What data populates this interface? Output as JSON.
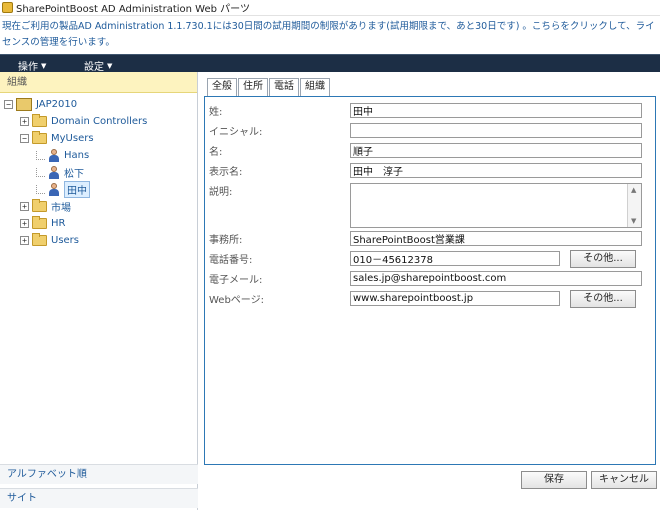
{
  "window": {
    "title": "SharePointBoost AD Administration Web パーツ",
    "icon": "app-icon"
  },
  "notice": {
    "text": "現在ご利用の製品AD Administration 1.1.730.1には30日間の試用期間の制限があります(試用期限まで、あと30日です) 。こちらをクリックして、ライセンスの管理を行います。"
  },
  "menu": {
    "items": [
      {
        "label": "操作",
        "icon": "caret-down-icon"
      },
      {
        "label": "設定",
        "icon": "caret-down-icon"
      }
    ]
  },
  "sidebar": {
    "header": "組織",
    "tree": [
      {
        "label": "JAP2010",
        "expander": "⊟",
        "icon": "domain-icon"
      },
      {
        "label": "Domain Controllers",
        "expander": "⊞",
        "icon": "folder-icon"
      },
      {
        "label": "MyUsers",
        "expander": "⊟",
        "icon": "folder-icon"
      },
      {
        "label": "Hans",
        "icon": "user-icon"
      },
      {
        "label": "松下",
        "icon": "user-icon"
      },
      {
        "label": "田中",
        "icon": "user-icon",
        "selected": true
      },
      {
        "label": "市場",
        "expander": "⊞",
        "icon": "folder-icon"
      },
      {
        "label": "HR",
        "expander": "⊞",
        "icon": "folder-icon"
      },
      {
        "label": "Users",
        "expander": "⊞",
        "icon": "folder-icon"
      }
    ],
    "footer": {
      "alpha": "アルファベット順",
      "site": "サイト"
    }
  },
  "tabs": [
    {
      "label": "全般",
      "active": true
    },
    {
      "label": "住所"
    },
    {
      "label": "電話"
    },
    {
      "label": "組織"
    }
  ],
  "form": {
    "last_name": {
      "label": "姓:",
      "value": "田中"
    },
    "initials": {
      "label": "イニシャル:",
      "value": ""
    },
    "first_name": {
      "label": "名:",
      "value": "順子"
    },
    "display_name": {
      "label": "表示名:",
      "value": "田中　淳子"
    },
    "description": {
      "label": "説明:",
      "value": ""
    },
    "office": {
      "label": "事務所:",
      "value": "SharePointBoost営業課"
    },
    "phone": {
      "label": "電話番号:",
      "value": "010－45612378",
      "other_label": "その他..."
    },
    "email": {
      "label": "電子メール:",
      "value": "sales.jp@sharepointboost.com"
    },
    "web_page": {
      "label": "Webページ:",
      "value": "www.sharepointboost.jp",
      "other_label": "その他..."
    }
  },
  "actions": {
    "save": "保存",
    "cancel": "キャンセル"
  },
  "colors": {
    "menubar": "#1c2e45",
    "accent": "#2d78b5",
    "header_bg": "#fdf3bf",
    "link": "#1e5a9a"
  }
}
